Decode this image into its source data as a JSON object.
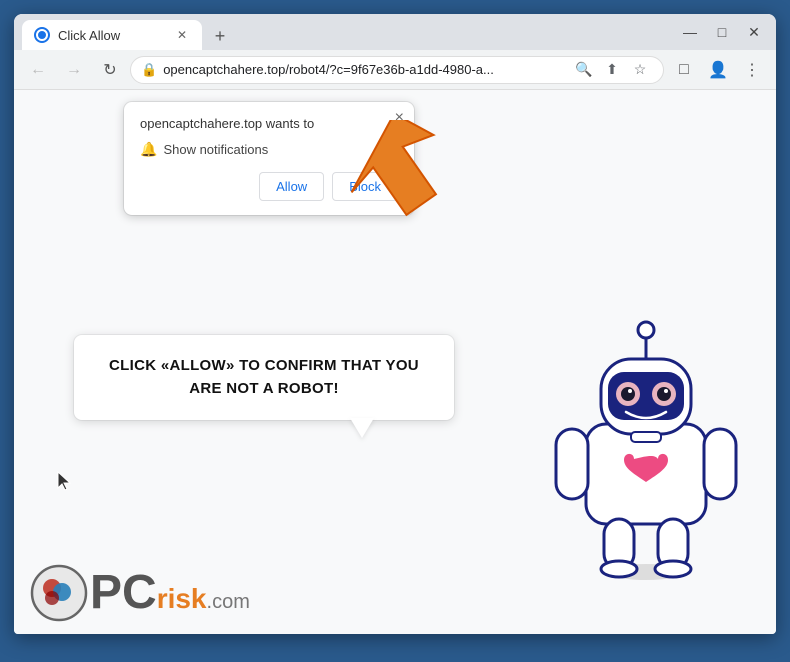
{
  "browser": {
    "tab": {
      "title": "Click Allow",
      "favicon_label": "tab-favicon"
    },
    "window_controls": {
      "minimize": "—",
      "maximize": "□",
      "close": "✕"
    },
    "nav": {
      "back": "←",
      "forward": "→",
      "reload": "↻",
      "url": "opencaptchahere.top/robot4/?c=9f67e36b-a1dd-4980-a...",
      "search_icon": "🔍",
      "share_icon": "⬆",
      "bookmark_icon": "☆",
      "extensions_icon": "□",
      "profile_icon": "👤",
      "menu_icon": "⋮"
    }
  },
  "notification_popup": {
    "title": "opencaptchahere.top wants to",
    "bell_icon": "🔔",
    "show_notifications": "Show notifications",
    "allow_label": "Allow",
    "block_label": "Block",
    "close_icon": "×"
  },
  "speech_bubble": {
    "text": "CLICK «ALLOW» TO CONFIRM THAT YOU ARE NOT A ROBOT!"
  },
  "pcrisk": {
    "pc_letters": "PC",
    "risk_text": "risk",
    "com_text": ".com"
  },
  "cursor": {
    "symbol": "↖"
  }
}
